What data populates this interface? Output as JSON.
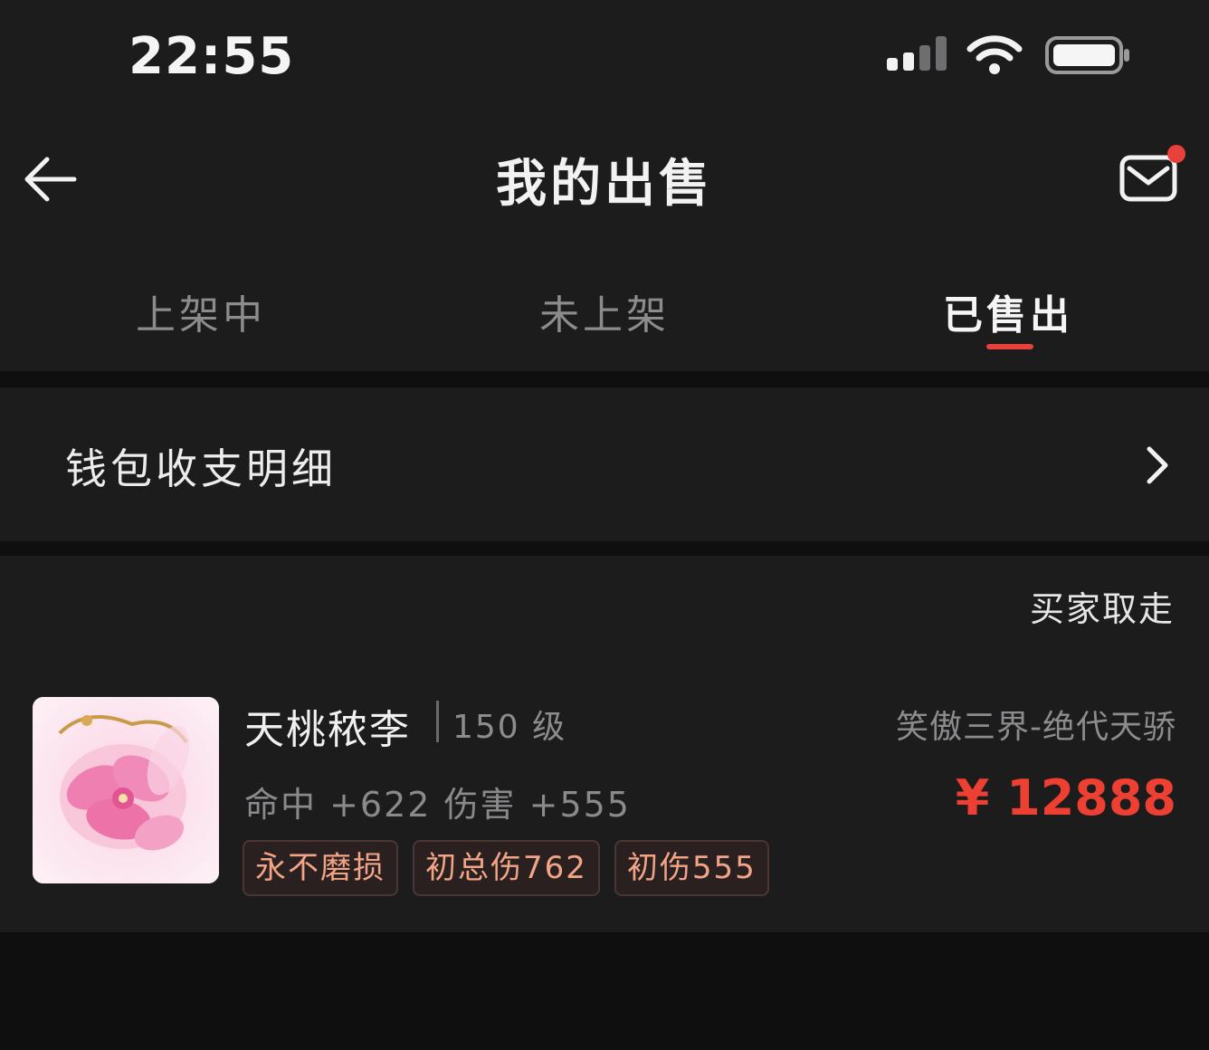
{
  "status_bar": {
    "time": "22:55",
    "icons": [
      "signal-icon",
      "wifi-icon",
      "battery-icon"
    ]
  },
  "nav": {
    "title": "我的出售",
    "back_icon": "back-arrow-icon",
    "mail_icon": "mail-icon",
    "mail_has_notification": true
  },
  "tabs": [
    {
      "label": "上架中",
      "active": false
    },
    {
      "label": "未上架",
      "active": false
    },
    {
      "label": "已售出",
      "active": true
    }
  ],
  "wallet": {
    "label": "钱包收支明细",
    "chevron_icon": "chevron-right-icon"
  },
  "order": {
    "status": "买家取走",
    "item_name": "天桃秾李",
    "level": "150 级",
    "server": "笑傲三界-绝代天骄",
    "stats": "命中 +622 伤害 +555",
    "price": "¥ 12888",
    "tags": [
      "永不磨损",
      "初总伤762",
      "初伤555"
    ]
  },
  "colors": {
    "accent": "#e8403a",
    "price": "#ee3f33",
    "tag_text": "#f2a487",
    "background": "#1c1c1d"
  }
}
